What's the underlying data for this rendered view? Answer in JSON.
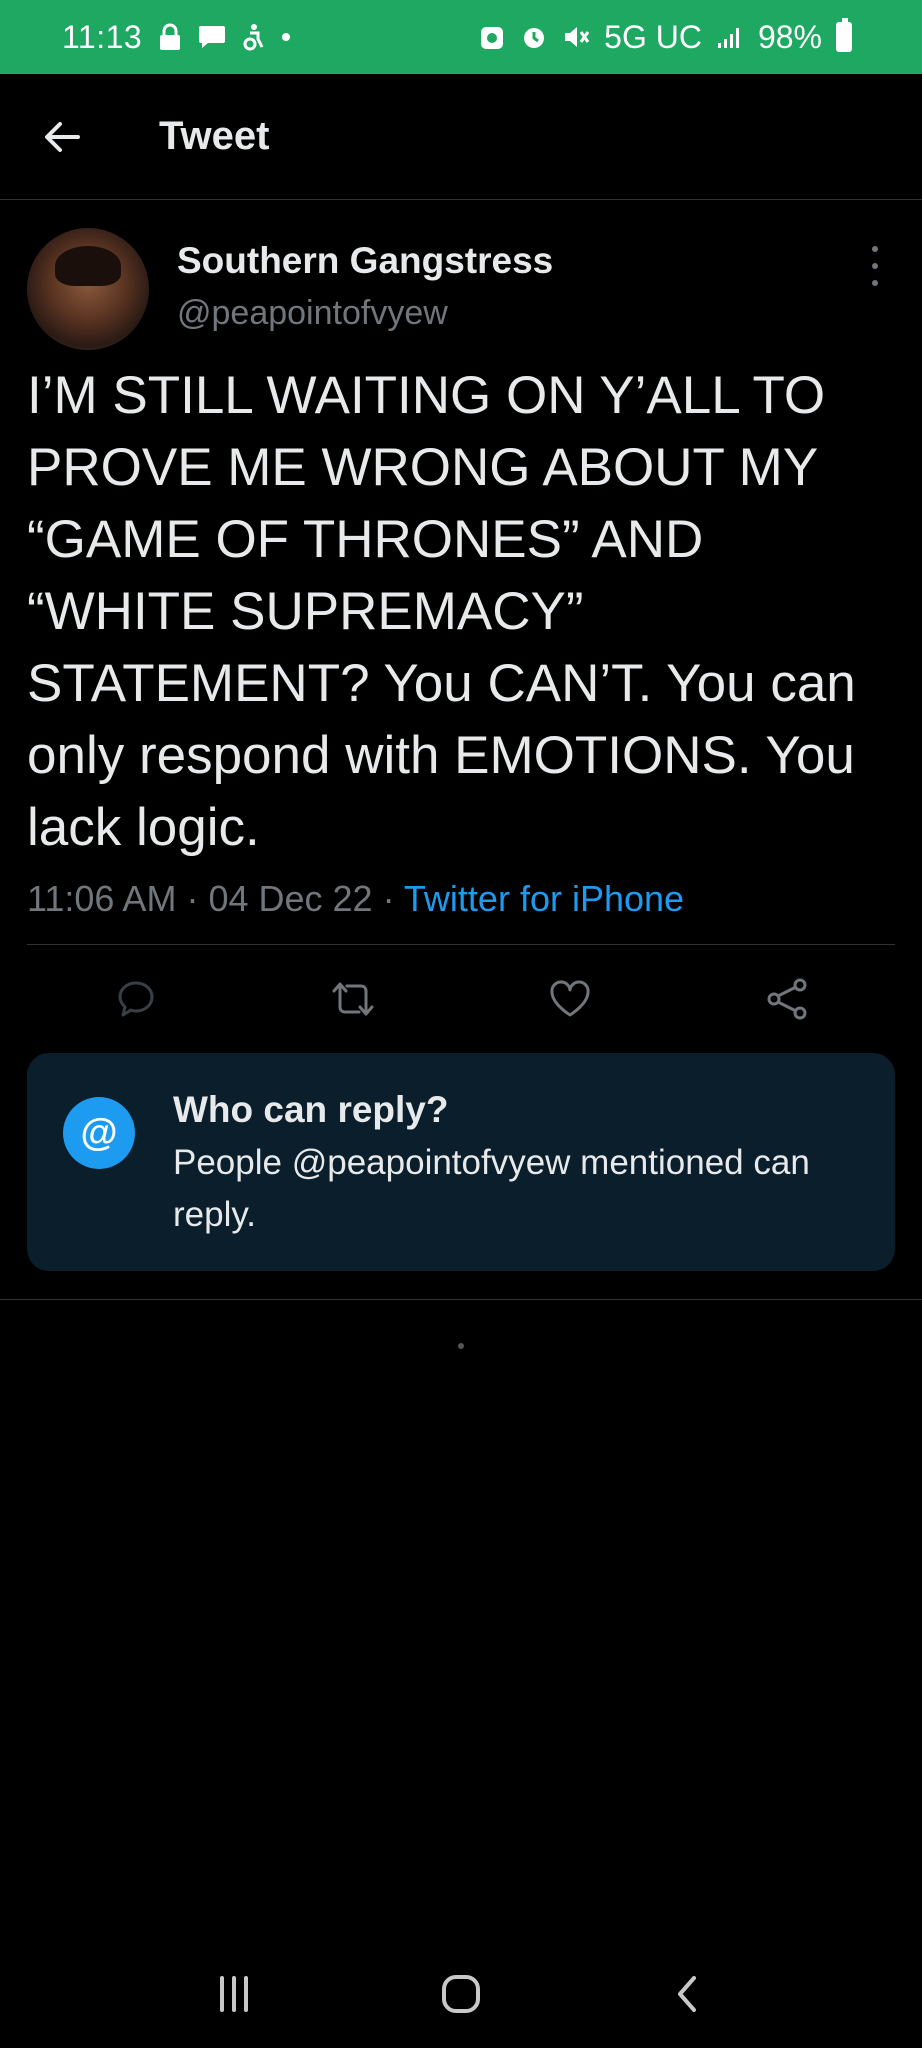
{
  "status_bar": {
    "time": "11:13",
    "network": "5G UC",
    "battery": "98%"
  },
  "header": {
    "title": "Tweet"
  },
  "tweet": {
    "display_name": "Southern Gangstress",
    "handle": "@peapointofvyew",
    "text": "I’M STILL WAITING ON Y’ALL TO PROVE ME WRONG ABOUT MY “GAME OF THRONES” AND “WHITE SUPREMACY” STATEMENT? You CAN’T. You can only respond with EMOTIONS. You lack logic.",
    "time": "11:06 AM",
    "date": "04 Dec 22",
    "source": "Twitter for iPhone"
  },
  "reply_settings": {
    "icon_label": "@",
    "title": "Who can reply?",
    "description": "People @peapointofvyew mentioned can reply."
  },
  "colors": {
    "status_bar": "#1fa862",
    "accent": "#1d9bf0",
    "secondary_text": "#71767b",
    "card_bg": "#0a1e2c"
  }
}
